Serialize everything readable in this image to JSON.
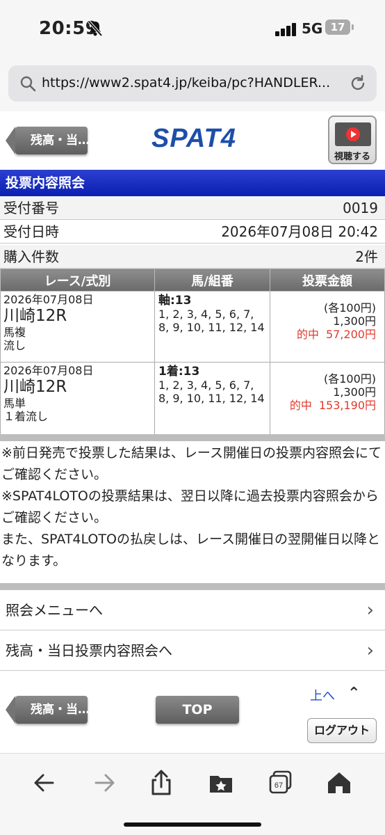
{
  "status": {
    "time": "20:59",
    "network": "5G",
    "battery": "17"
  },
  "browser": {
    "url": "https://www2.spat4.jp/keiba/pc?HANDLER..."
  },
  "header": {
    "back_label": "残高・当…",
    "logo": "SPAT4",
    "video_label": "視聴する"
  },
  "page": {
    "title": "投票内容照会"
  },
  "info": [
    {
      "label": "受付番号",
      "value": "0019"
    },
    {
      "label": "受付日時",
      "value": "2026年07月08日 20:42"
    },
    {
      "label": "購入件数",
      "value": "2件"
    }
  ],
  "table": {
    "headers": [
      "レース/式別",
      "馬/組番",
      "投票金額"
    ],
    "rows": [
      {
        "date": "2026年07月08日",
        "race": "川崎12R",
        "bet_type": "馬複",
        "method": "流し",
        "axis": "軸:13",
        "combos": "1, 2, 3, 4, 5, 6, 7, 8, 9, 10, 11, 12, 14",
        "unit": "(各100円)",
        "amount": "1,300円",
        "hit_label": "的中",
        "hit_amount": "57,200円"
      },
      {
        "date": "2026年07月08日",
        "race": "川崎12R",
        "bet_type": "馬単",
        "method": "１着流し",
        "axis": "1着:13",
        "combos": "1, 2, 3, 4, 5, 6, 7, 8, 9, 10, 11, 12, 14",
        "unit": "(各100円)",
        "amount": "1,300円",
        "hit_label": "的中",
        "hit_amount": "153,190円"
      }
    ]
  },
  "notes": [
    "※前日発売で投票した結果は、レース開催日の投票内容照会にてご確認ください。",
    "※SPAT4LOTOの投票結果は、翌日以降に過去投票内容照会からご確認ください。",
    "また、SPAT4LOTOの払戻しは、レース開催日の翌開催日以降となります。"
  ],
  "menu": [
    {
      "label": "照会メニューへ"
    },
    {
      "label": "残高・当日投票内容照会へ"
    }
  ],
  "footer": {
    "back_label": "残高・当…",
    "top_label": "TOP",
    "up_label": "上へ",
    "logout_label": "ログアウト"
  },
  "toolbar": {
    "tab_count": "67"
  },
  "colors": {
    "title_bar": "#0a1fb0",
    "hit": "#e03a2c",
    "logo": "#1d4fa8"
  }
}
